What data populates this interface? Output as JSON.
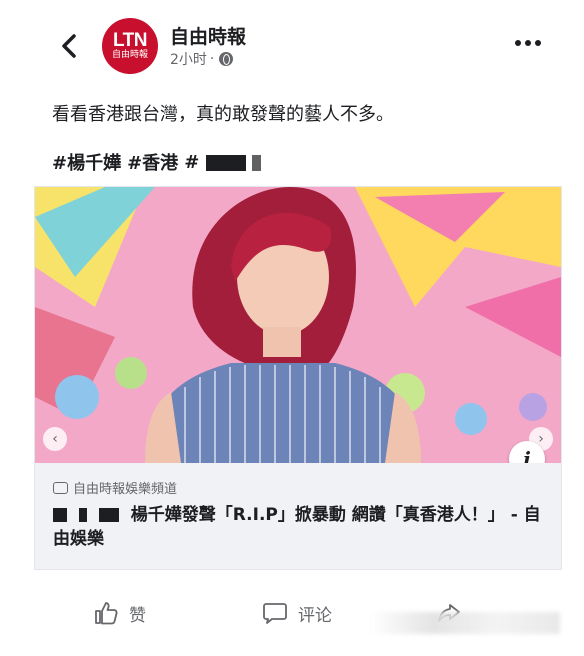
{
  "post": {
    "page_name": "自由時報",
    "avatar_logo": "LTN",
    "avatar_sub": "自由時報",
    "time": "2小时",
    "separator": "·",
    "text": "看看香港跟台灣，真的敢發聲的藝人不多。",
    "tags": [
      "#楊千嬅",
      "#香港",
      "#"
    ]
  },
  "card": {
    "source": "自由時報娛樂頻道",
    "headline": "楊千嬅發聲「R.I.P」掀暴動 網讚「真香港人！」 - 自由娛樂",
    "info_label": "i"
  },
  "actions": {
    "like": "赞",
    "comment": "评论"
  },
  "colors": {
    "brand": "#c8102e",
    "card_bg": "#f0f2f5",
    "muted": "#65676b"
  }
}
